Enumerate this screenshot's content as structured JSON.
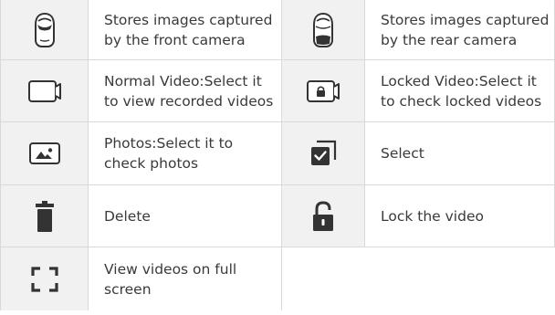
{
  "rows": [
    {
      "left": {
        "icon": "front-camera-car-icon",
        "text": "Stores images captured by the front camera"
      },
      "right": {
        "icon": "rear-camera-car-icon",
        "text": "Stores images captured by the rear camera"
      }
    },
    {
      "left": {
        "icon": "normal-video-icon",
        "text": "Normal Video:Select it to view recorded videos"
      },
      "right": {
        "icon": "locked-video-icon",
        "text": "Locked Video:Select it to check locked videos"
      }
    },
    {
      "left": {
        "icon": "photos-icon",
        "text": "Photos:Select it to check photos"
      },
      "right": {
        "icon": "select-checkbox-icon",
        "text": "Select"
      }
    },
    {
      "left": {
        "icon": "trash-icon",
        "text": "Delete"
      },
      "right": {
        "icon": "unlocked-padlock-icon",
        "text": "Lock the video"
      }
    },
    {
      "left": {
        "icon": "fullscreen-icon",
        "text": "View videos on full screen"
      }
    }
  ]
}
